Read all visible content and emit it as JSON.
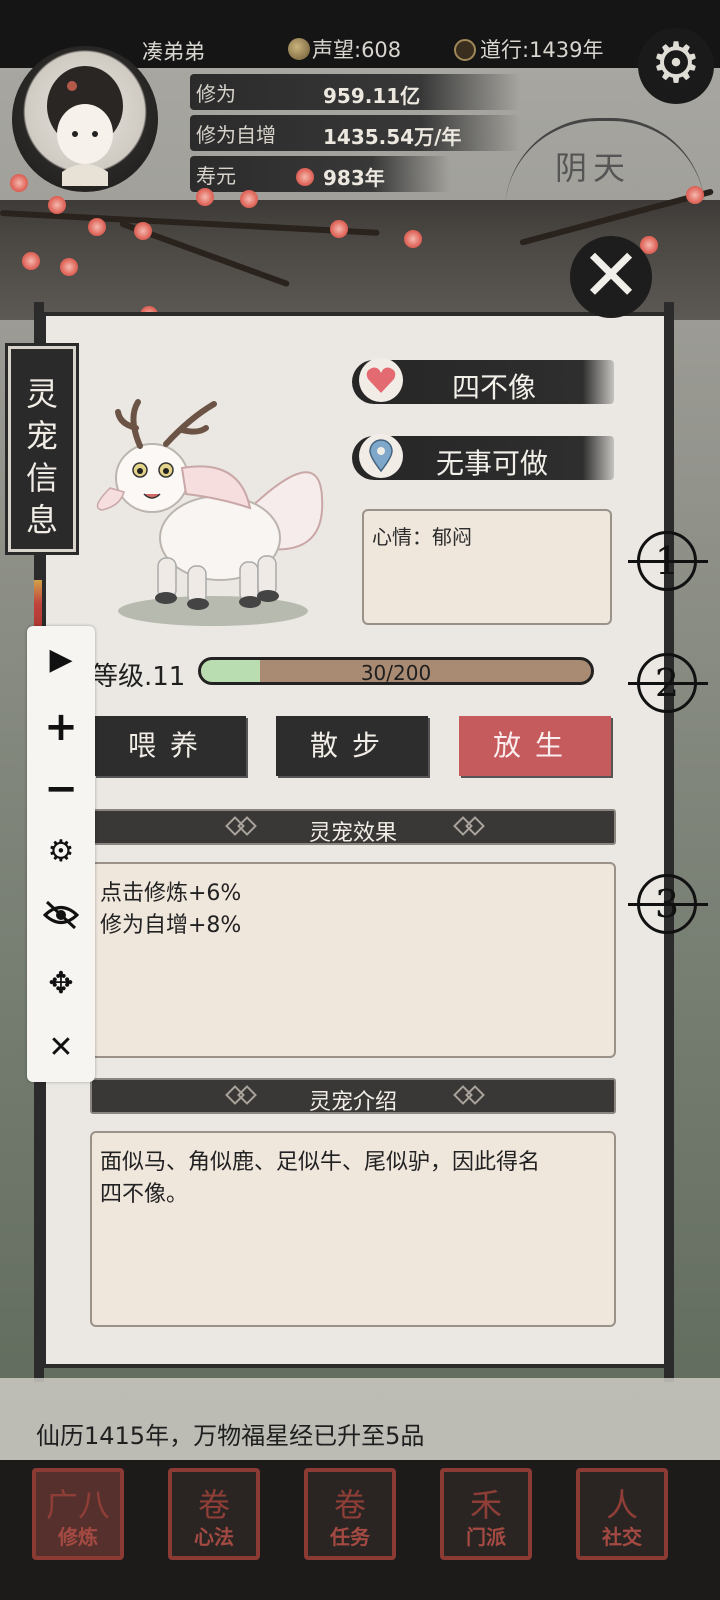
{
  "header": {
    "player_name": "凑弟弟",
    "reputation": "声望:608",
    "daoxing": "道行:1439年"
  },
  "stats": {
    "cultivation_label": "修为",
    "cultivation_value": "959.11亿",
    "growth_label": "修为自增",
    "growth_value": "1435.54万/年",
    "lifespan_label": "寿元",
    "lifespan_value": "983年"
  },
  "weather": "阴天",
  "panel": {
    "title_chars": [
      "灵",
      "宠",
      "信",
      "息"
    ],
    "pet_name": "四不像",
    "pet_status": "无事可做",
    "mood": "心情：郁闷",
    "level_label": "等级.11",
    "xp_text": "30/200",
    "xp_fraction": 0.15,
    "actions": {
      "feed": "喂养",
      "walk": "散步",
      "release": "放生"
    },
    "effects_header": "灵宠效果",
    "effects": [
      "点击修炼+6%",
      "修为自增+8%"
    ],
    "intro_header": "灵宠介绍",
    "intro_lines": [
      "面似马、角似鹿、足似牛、尾似驴，因此得名",
      "四不像。"
    ]
  },
  "markers": [
    "1",
    "2",
    "3"
  ],
  "news": "仙历1415年，万物福星经已升至5品",
  "nav": [
    {
      "label": "修炼",
      "glyph": "广八"
    },
    {
      "label": "心法",
      "glyph": "卷"
    },
    {
      "label": "任务",
      "glyph": "卷"
    },
    {
      "label": "门派",
      "glyph": "禾"
    },
    {
      "label": "社交",
      "glyph": "人"
    }
  ],
  "toolbar_icons": [
    "play-icon",
    "plus-icon",
    "minus-icon",
    "gear-icon",
    "eye-off-icon",
    "move-icon",
    "close-icon"
  ],
  "colors": {
    "release_button": "#c65b5e",
    "xp_fill": "#b9dcb1",
    "xp_track": "#a98a73",
    "accent_red": "#8c3b34"
  }
}
